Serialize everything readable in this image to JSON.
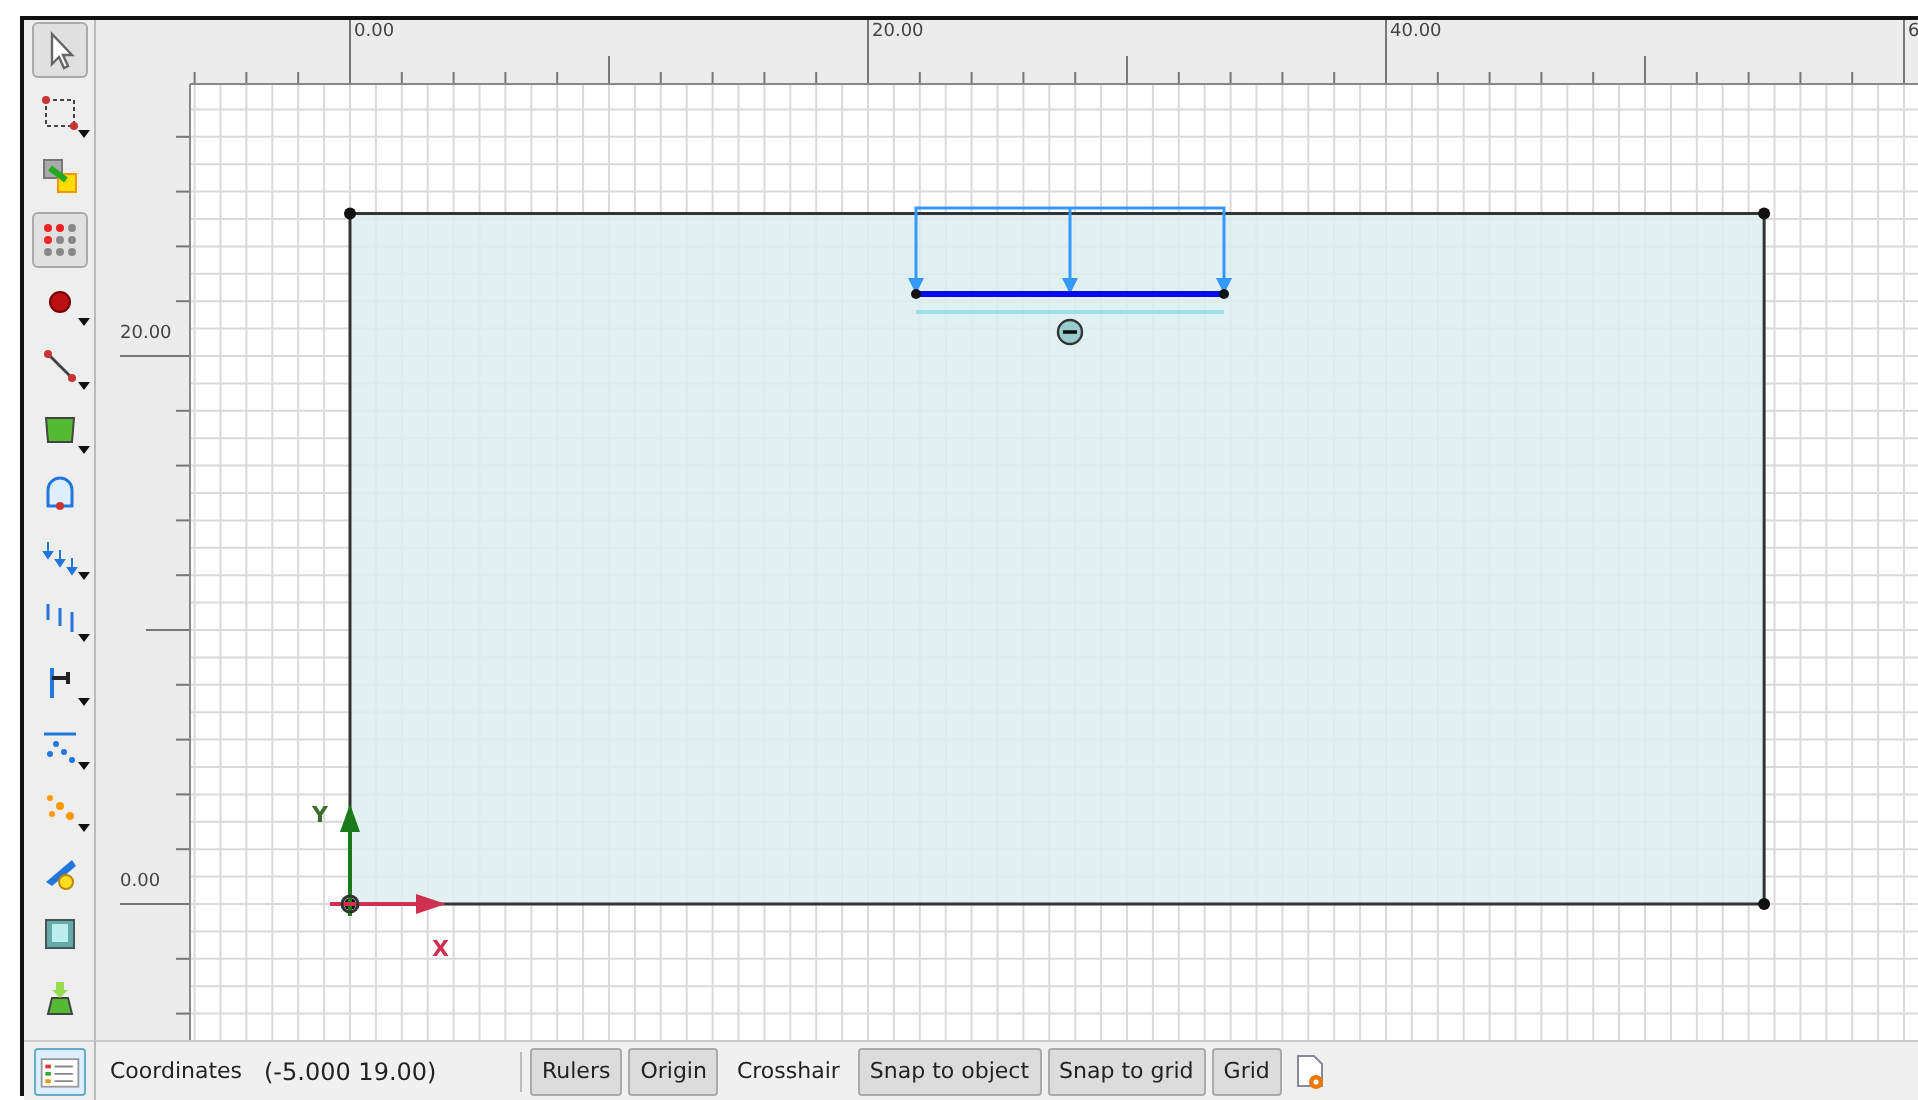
{
  "toolbar": {
    "tools": [
      {
        "kind": "pointer",
        "selected": true,
        "menu": false
      },
      {
        "kind": "marquee",
        "selected": false,
        "menu": true
      },
      {
        "kind": "squares",
        "selected": false,
        "menu": false
      },
      {
        "kind": "dots",
        "selected": true,
        "menu": false
      },
      {
        "kind": "point",
        "selected": false,
        "menu": true
      },
      {
        "kind": "line",
        "selected": false,
        "menu": true
      },
      {
        "kind": "polygon",
        "selected": false,
        "menu": true
      },
      {
        "kind": "tunnel",
        "selected": false,
        "menu": false
      },
      {
        "kind": "point-loads",
        "selected": false,
        "menu": true
      },
      {
        "kind": "line-loads",
        "selected": false,
        "menu": true
      },
      {
        "kind": "anchor",
        "selected": false,
        "menu": true
      },
      {
        "kind": "water",
        "selected": false,
        "menu": true
      },
      {
        "kind": "sparks",
        "selected": false,
        "menu": true
      },
      {
        "kind": "brush",
        "selected": false,
        "menu": false
      },
      {
        "kind": "frame",
        "selected": false,
        "menu": false
      },
      {
        "kind": "import",
        "selected": false,
        "menu": false
      }
    ]
  },
  "rulers": {
    "horizontal": [
      {
        "label": "0.00"
      },
      {
        "label": "20.00"
      },
      {
        "label": "40.00"
      },
      {
        "label": "6"
      }
    ],
    "vertical": [
      {
        "label": "20.00"
      },
      {
        "label": "0.00"
      }
    ]
  },
  "canvas": {
    "axes": {
      "x_label": "X",
      "y_label": "Y"
    }
  },
  "status_bar": {
    "label": "Coordinates",
    "value": "(-5.000 19.00)",
    "toggles": [
      {
        "label": "Rulers",
        "on": true
      },
      {
        "label": "Origin",
        "on": true
      },
      {
        "label": "Crosshair",
        "on": false
      },
      {
        "label": "Snap to object",
        "on": true
      },
      {
        "label": "Snap to grid",
        "on": true
      },
      {
        "label": "Grid",
        "on": true
      }
    ]
  }
}
